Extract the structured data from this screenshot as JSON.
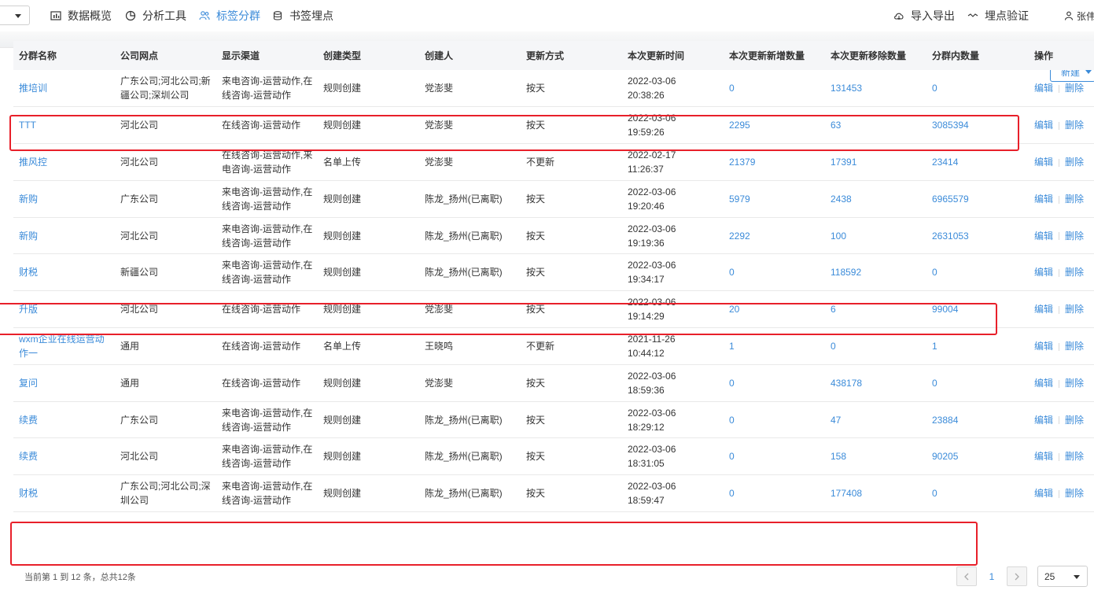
{
  "nav": {
    "items": [
      {
        "label": "数据概览",
        "icon": "chart-icon"
      },
      {
        "label": "分析工具",
        "icon": "pie-icon"
      },
      {
        "label": "标签分群",
        "icon": "people-icon"
      },
      {
        "label": "书签埋点",
        "icon": "database-icon"
      }
    ],
    "right": [
      {
        "label": "导入导出",
        "icon": "cloud-icon"
      },
      {
        "label": "埋点验证",
        "icon": "verify-icon"
      },
      {
        "label": "张伟",
        "icon": "user-icon"
      }
    ]
  },
  "toolbar": {
    "new_label": "新建"
  },
  "table": {
    "headers": [
      "分群名称",
      "公司网点",
      "显示渠道",
      "创建类型",
      "创建人",
      "更新方式",
      "本次更新时间",
      "本次更新新增数量",
      "本次更新移除数量",
      "分群内数量",
      "操作"
    ],
    "rows": [
      {
        "name": "推培训",
        "company": "广东公司;河北公司;新疆公司;深圳公司",
        "channel": "来电咨询-运营动作,在线咨询-运营动作",
        "ctype": "规则创建",
        "creator": "党澎斐",
        "mode": "按天",
        "date": "2022-03-06",
        "time": "20:38:26",
        "added": "0",
        "removed": "131453",
        "count": "0",
        "edit": "编辑",
        "del": "删除"
      },
      {
        "name": "TTT",
        "company": "河北公司",
        "channel": "在线咨询-运营动作",
        "ctype": "规则创建",
        "creator": "党澎斐",
        "mode": "按天",
        "date": "2022-03-06",
        "time": "19:59:26",
        "added": "2295",
        "removed": "63",
        "count": "3085394",
        "edit": "编辑",
        "del": "删除"
      },
      {
        "name": "推风控",
        "company": "河北公司",
        "channel": "在线咨询-运营动作,来电咨询-运营动作",
        "ctype": "名单上传",
        "creator": "党澎斐",
        "mode": "不更新",
        "date": "2022-02-17",
        "time": "11:26:37",
        "added": "21379",
        "removed": "17391",
        "count": "23414",
        "edit": "编辑",
        "del": "删除"
      },
      {
        "name": "新购",
        "company": "广东公司",
        "channel": "来电咨询-运营动作,在线咨询-运营动作",
        "ctype": "规则创建",
        "creator": "陈龙_扬州(已离职)",
        "mode": "按天",
        "date": "2022-03-06",
        "time": "19:20:46",
        "added": "5979",
        "removed": "2438",
        "count": "6965579",
        "edit": "编辑",
        "del": "删除"
      },
      {
        "name": "新购",
        "company": "河北公司",
        "channel": "来电咨询-运营动作,在线咨询-运营动作",
        "ctype": "规则创建",
        "creator": "陈龙_扬州(已离职)",
        "mode": "按天",
        "date": "2022-03-06",
        "time": "19:19:36",
        "added": "2292",
        "removed": "100",
        "count": "2631053",
        "edit": "编辑",
        "del": "删除"
      },
      {
        "name": "财税",
        "company": "新疆公司",
        "channel": "来电咨询-运营动作,在线咨询-运营动作",
        "ctype": "规则创建",
        "creator": "陈龙_扬州(已离职)",
        "mode": "按天",
        "date": "2022-03-06",
        "time": "19:34:17",
        "added": "0",
        "removed": "118592",
        "count": "0",
        "edit": "编辑",
        "del": "删除"
      },
      {
        "name": "升版",
        "company": "河北公司",
        "channel": "在线咨询-运营动作",
        "ctype": "规则创建",
        "creator": "党澎斐",
        "mode": "按天",
        "date": "2022-03-06",
        "time": "19:14:29",
        "added": "20",
        "removed": "6",
        "count": "99004",
        "edit": "编辑",
        "del": "删除"
      },
      {
        "name": "wxm企业在线运营动作一",
        "company": "通用",
        "channel": "在线咨询-运营动作",
        "ctype": "名单上传",
        "creator": "王晓鸣",
        "mode": "不更新",
        "date": "2021-11-26",
        "time": "10:44:12",
        "added": "1",
        "removed": "0",
        "count": "1",
        "edit": "编辑",
        "del": "删除"
      },
      {
        "name": "复问",
        "company": "通用",
        "channel": "在线咨询-运营动作",
        "ctype": "规则创建",
        "creator": "党澎斐",
        "mode": "按天",
        "date": "2022-03-06",
        "time": "18:59:36",
        "added": "0",
        "removed": "438178",
        "count": "0",
        "edit": "编辑",
        "del": "删除"
      },
      {
        "name": "续费",
        "company": "广东公司",
        "channel": "来电咨询-运营动作,在线咨询-运营动作",
        "ctype": "规则创建",
        "creator": "陈龙_扬州(已离职)",
        "mode": "按天",
        "date": "2022-03-06",
        "time": "18:29:12",
        "added": "0",
        "removed": "47",
        "count": "23884",
        "edit": "编辑",
        "del": "删除"
      },
      {
        "name": "续费",
        "company": "河北公司",
        "channel": "来电咨询-运营动作,在线咨询-运营动作",
        "ctype": "规则创建",
        "creator": "陈龙_扬州(已离职)",
        "mode": "按天",
        "date": "2022-03-06",
        "time": "18:31:05",
        "added": "0",
        "removed": "158",
        "count": "90205",
        "edit": "编辑",
        "del": "删除"
      },
      {
        "name": "财税",
        "company": "广东公司;河北公司;深圳公司",
        "channel": "来电咨询-运营动作,在线咨询-运营动作",
        "ctype": "规则创建",
        "creator": "陈龙_扬州(已离职)",
        "mode": "按天",
        "date": "2022-03-06",
        "time": "18:59:47",
        "added": "0",
        "removed": "177408",
        "count": "0",
        "edit": "编辑",
        "del": "删除"
      }
    ]
  },
  "footer": {
    "summary": "当前第 1 到 12 条，总共12条",
    "page": "1",
    "page_size": "25"
  },
  "colors": {
    "accent": "#3b8bd9",
    "highlight": "#e8202a"
  }
}
